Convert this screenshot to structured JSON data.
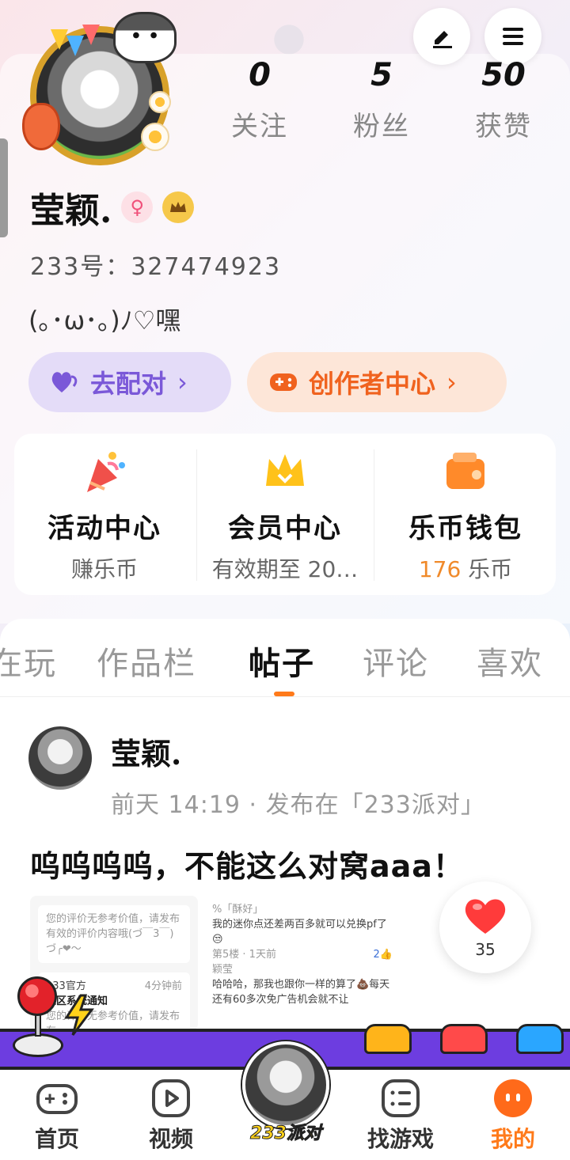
{
  "stats": [
    {
      "value": "0",
      "label": "关注"
    },
    {
      "value": "5",
      "label": "粉丝"
    },
    {
      "value": "50",
      "label": "获赞"
    }
  ],
  "profile": {
    "name": "莹颖.",
    "gender_badge": "♀",
    "uid": "233号：327474923",
    "bio": "(｡･ω･｡)ﾉ♡嘿"
  },
  "actions": {
    "match_label": "去配对",
    "creator_label": "创作者中心",
    "chevron": "›"
  },
  "quick": [
    {
      "title": "活动中心",
      "subtitle": "赚乐币"
    },
    {
      "title": "会员中心",
      "subtitle": "有效期至 20…"
    },
    {
      "title": "乐币钱包",
      "amount": "176",
      "unit": "乐币"
    }
  ],
  "tabs": [
    "在玩",
    "作品栏",
    "帖子",
    "评论",
    "喜欢"
  ],
  "active_tab": "帖子",
  "post": {
    "author": "莹颖.",
    "meta": "前天 14:19 · 发布在「233派对」",
    "text": "呜呜呜呜，不能这么对窝aaa！",
    "like_count": "35",
    "screenshot": {
      "left_card1": "您的评价无参考价值，请发布有效的评价内容哦(づ￣3￣)づ╭❤～",
      "left_card2_source": "233官方",
      "left_card2_time": "4分钟前",
      "left_card2_title": "社区系统通知",
      "left_card2_body": "您的评价无参考价值，请发布有",
      "right_user": "%「酥好」",
      "right_comment": "我的迷你点还差两百多就可以兑换pf了😒",
      "right_meta": "第5楼 · 1天前",
      "right_likes": "2👍",
      "right_reply_user": "颖莹",
      "right_reply": "哈哈哈，那我也跟你一样的算了💩每天还有60多次免广告机会就不让"
    }
  },
  "bottom_nav": [
    {
      "label": "首页"
    },
    {
      "label": "视频"
    },
    {
      "label": "233派对"
    },
    {
      "label": "找游戏"
    },
    {
      "label": "我的"
    }
  ],
  "colors": {
    "accent_orange": "#ff7a1a",
    "match_purple": "#7a58d8",
    "creator_orange": "#f0621e",
    "coin_orange": "#f08a2a"
  }
}
